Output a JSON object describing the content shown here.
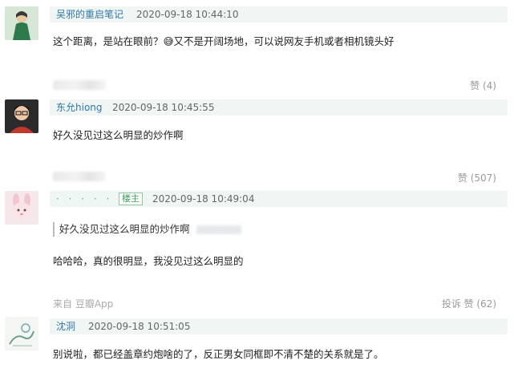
{
  "comments": [
    {
      "user": "吴邪的重启笔记",
      "time": "2020-09-18 10:44:10",
      "text": "这个距离，是站在眼前？😅又不是开阔场地，可以说网友手机或者相机镜头好",
      "like_label": "赞 (4)"
    },
    {
      "user": "东允hiong",
      "time": "2020-09-18 10:45:55",
      "text": "好久没见过这么明显的炒作啊",
      "like_label": "赞 (507)"
    },
    {
      "user": "· · · · · ·",
      "badge": "楼主",
      "time": "2020-09-18 10:49:04",
      "quote": "好久没见过这么明显的炒作啊",
      "text": "哈哈哈，真的很明显，我没见过这么明显的",
      "source": "来自 豆瓣App",
      "report_label": "投诉",
      "like_label": "赞 (62)"
    },
    {
      "user": "沈洞",
      "time": "2020-09-18 10:51:05",
      "text": "别说啦，都已经盖章约炮啥的了，反正男女同框即不清不楚的关系就是了。"
    }
  ],
  "icons": {
    "avatar_1": "avatar-figure-green",
    "avatar_2": "avatar-person-dark",
    "avatar_3": "avatar-pink-cartoon",
    "avatar_4": "avatar-sketch"
  }
}
